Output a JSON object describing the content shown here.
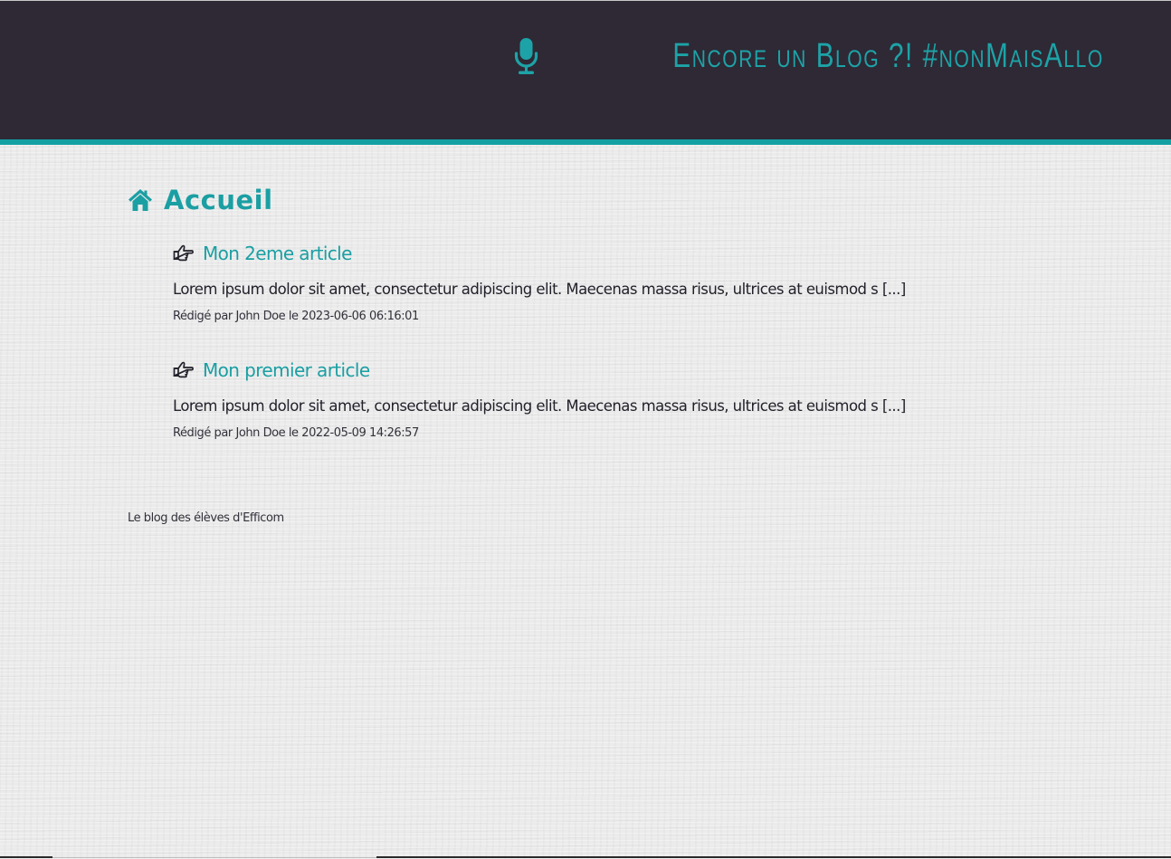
{
  "header": {
    "title": "Encore un Blog ?! #nonMaisAllo",
    "icon": "microphone-icon",
    "background_color": "#2e2935",
    "accent_color": "#14a0a3"
  },
  "main": {
    "heading": {
      "icon": "home-icon",
      "label": "Accueil"
    },
    "articles": [
      {
        "icon": "hand-pointer-right-icon",
        "title": "Mon 2eme article",
        "excerpt": "Lorem ipsum dolor sit amet, consectetur adipiscing elit. Maecenas massa risus, ultrices at euismod s [...]",
        "meta": "Rédigé par John Doe le 2023-06-06 06:16:01"
      },
      {
        "icon": "hand-pointer-right-icon",
        "title": "Mon premier article",
        "excerpt": "Lorem ipsum dolor sit amet, consectetur adipiscing elit. Maecenas massa risus, ultrices at euismod s [...]",
        "meta": "Rédigé par John Doe le 2022-05-09 14:26:57"
      }
    ]
  },
  "footer": {
    "text": "Le blog des élèves d'Efficom"
  },
  "colors": {
    "link": "#1a9fa3",
    "text": "#23202a",
    "page_background": "#ebebeb"
  }
}
